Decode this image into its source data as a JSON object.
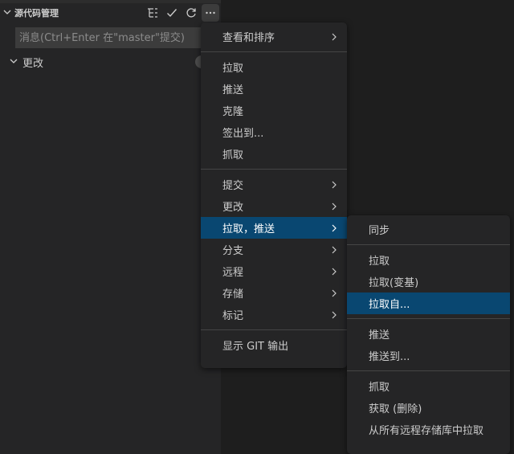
{
  "section": {
    "title": "源代码管理",
    "collapse_glyph": "⌵",
    "icons": [
      "list-tree-icon",
      "check-icon",
      "refresh-icon",
      "more-icon"
    ]
  },
  "commit": {
    "placeholder": "消息(Ctrl+Enter 在\"master\"提交)"
  },
  "changes": {
    "label": "更改"
  },
  "main_menu": {
    "view_sort": "查看和排序",
    "pull": "拉取",
    "push": "推送",
    "clone": "克隆",
    "checkout": "签出到...",
    "fetch": "抓取",
    "commit": "提交",
    "changes": "更改",
    "pull_push": "拉取，推送",
    "branch": "分支",
    "remote": "远程",
    "stash": "存储",
    "tags": "标记",
    "show_git_output": "显示 GIT 输出"
  },
  "sub_menu": {
    "sync": "同步",
    "pull": "拉取",
    "pull_rebase": "拉取(变基)",
    "pull_from": "拉取自...",
    "push": "推送",
    "push_to": "推送到...",
    "fetch": "抓取",
    "fetch_prune": "获取 (删除)",
    "fetch_all": "从所有远程存储库中拉取"
  },
  "colors": {
    "sidebar_bg": "#252526",
    "editor_bg": "#1e1e1e",
    "menu_highlight": "#094771",
    "input_bg": "#3c3c3c"
  }
}
